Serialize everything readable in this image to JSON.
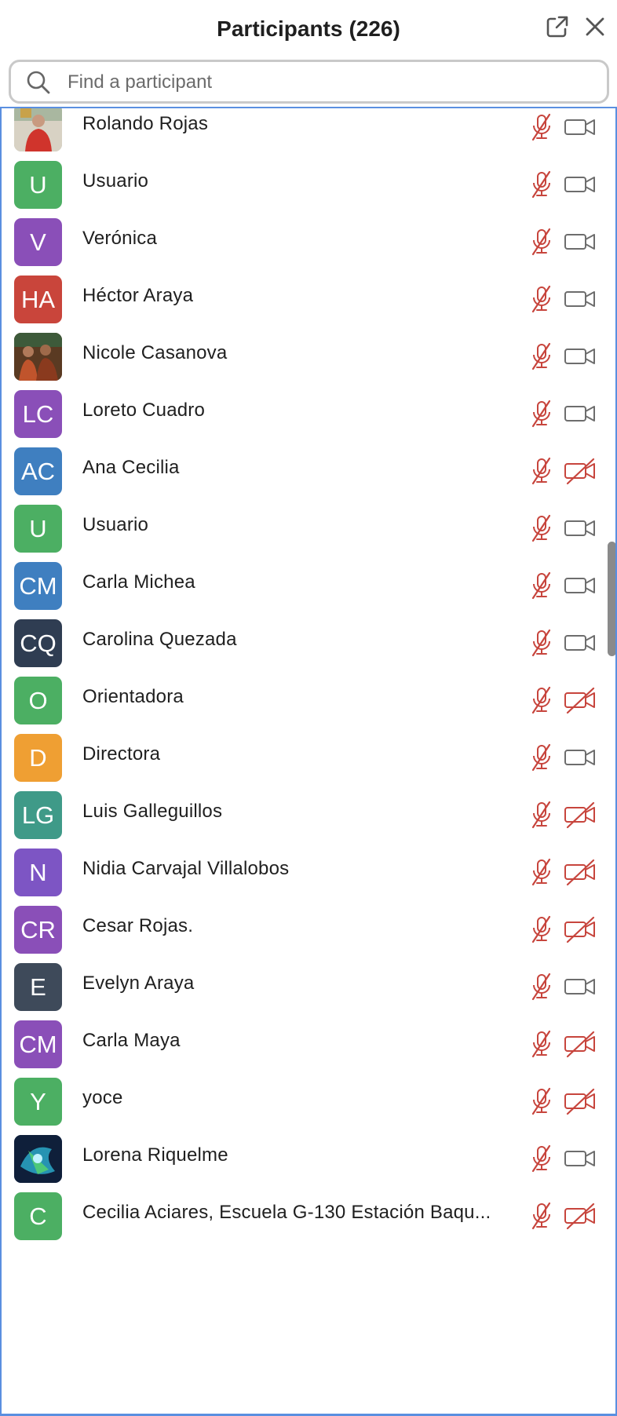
{
  "header": {
    "title": "Participants",
    "count": "(226)",
    "popout_icon": "popout-icon",
    "close_icon": "close-icon"
  },
  "search": {
    "placeholder": "Find a participant",
    "value": ""
  },
  "colors": {
    "muted_red": "#c7453d",
    "icon_gray": "#6d6d6d",
    "list_border": "#5a8fe0"
  },
  "participants": [
    {
      "name": "Rolando Rojas",
      "initials": "",
      "avatar": "photo-person",
      "color": "#b9b3a9",
      "muted": true,
      "video_off": false
    },
    {
      "name": "Usuario",
      "initials": "U",
      "avatar": "initials",
      "color": "#4caf63",
      "muted": true,
      "video_off": false
    },
    {
      "name": "Verónica",
      "initials": "V",
      "avatar": "initials",
      "color": "#8a4fb8",
      "muted": true,
      "video_off": false
    },
    {
      "name": "Héctor Araya",
      "initials": "HA",
      "avatar": "initials",
      "color": "#c9453b",
      "muted": true,
      "video_off": false
    },
    {
      "name": "Nicole Casanova",
      "initials": "",
      "avatar": "photo-group",
      "color": "#7a4a2a",
      "muted": true,
      "video_off": false
    },
    {
      "name": "Loreto Cuadro",
      "initials": "LC",
      "avatar": "initials",
      "color": "#8a4fb8",
      "muted": true,
      "video_off": false
    },
    {
      "name": "Ana Cecilia",
      "initials": "AC",
      "avatar": "initials",
      "color": "#3f7fc0",
      "muted": true,
      "video_off": true
    },
    {
      "name": "Usuario",
      "initials": "U",
      "avatar": "initials",
      "color": "#4caf63",
      "muted": true,
      "video_off": false
    },
    {
      "name": "Carla Michea",
      "initials": "CM",
      "avatar": "initials",
      "color": "#3f7fc0",
      "muted": true,
      "video_off": false
    },
    {
      "name": "Carolina Quezada",
      "initials": "CQ",
      "avatar": "initials",
      "color": "#2f3d52",
      "muted": true,
      "video_off": false
    },
    {
      "name": "Orientadora",
      "initials": "O",
      "avatar": "initials",
      "color": "#4caf63",
      "muted": true,
      "video_off": true
    },
    {
      "name": "Directora",
      "initials": "D",
      "avatar": "initials",
      "color": "#ef9f33",
      "muted": true,
      "video_off": false
    },
    {
      "name": "Luis Galleguillos",
      "initials": "LG",
      "avatar": "initials",
      "color": "#3f9a88",
      "muted": true,
      "video_off": true
    },
    {
      "name": "Nidia Carvajal Villalobos",
      "initials": "N",
      "avatar": "initials",
      "color": "#7d55c4",
      "muted": true,
      "video_off": true
    },
    {
      "name": "Cesar Rojas.",
      "initials": "CR",
      "avatar": "initials",
      "color": "#8a4fb8",
      "muted": true,
      "video_off": true
    },
    {
      "name": "Evelyn Araya",
      "initials": "E",
      "avatar": "initials",
      "color": "#3e4a5a",
      "muted": true,
      "video_off": false
    },
    {
      "name": "Carla Maya",
      "initials": "CM",
      "avatar": "initials",
      "color": "#8a4fb8",
      "muted": true,
      "video_off": true
    },
    {
      "name": "yoce",
      "initials": "Y",
      "avatar": "initials",
      "color": "#4caf63",
      "muted": true,
      "video_off": true
    },
    {
      "name": "Lorena Riquelme",
      "initials": "",
      "avatar": "photo-abstract",
      "color": "#1d3a6a",
      "muted": true,
      "video_off": false
    },
    {
      "name": "Cecilia Aciares, Escuela G-130 Estación Baqu...",
      "initials": "C",
      "avatar": "initials",
      "color": "#4caf63",
      "muted": true,
      "video_off": true
    }
  ]
}
